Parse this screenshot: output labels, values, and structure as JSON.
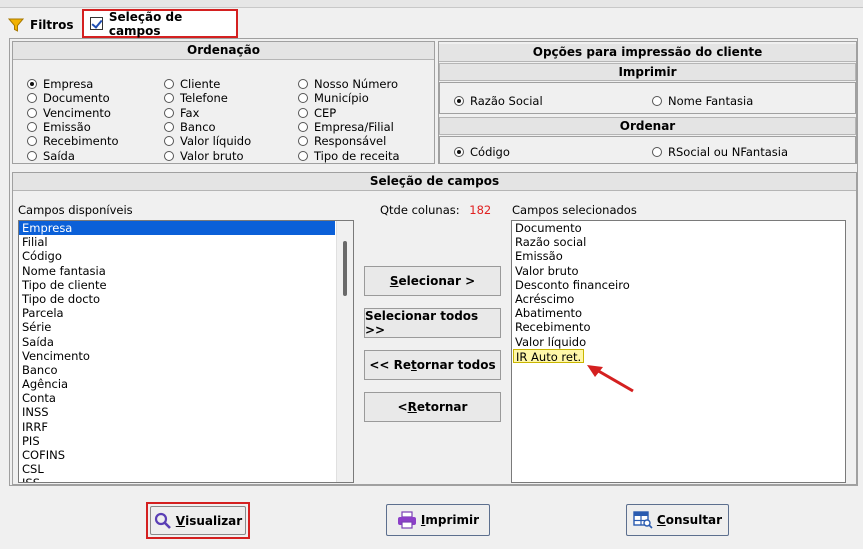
{
  "tabs": {
    "filtros": "Filtros",
    "selecao": "Seleção de campos"
  },
  "ordenacao": {
    "title": "Ordenação",
    "col1": [
      "Empresa",
      "Documento",
      "Vencimento",
      "Emissão",
      "Recebimento",
      "Saída"
    ],
    "col2": [
      "Cliente",
      "Telefone",
      "Fax",
      "Banco",
      "Valor líquido",
      "Valor bruto"
    ],
    "col3": [
      "Nosso Número",
      "Município",
      "CEP",
      "Empresa/Filial",
      "Responsável",
      "Tipo de receita"
    ],
    "selected": "Empresa"
  },
  "opcoes": {
    "title": "Opções para impressão do cliente",
    "imprimir_title": "Imprimir",
    "imprimir_opts": [
      "Razão Social",
      "Nome Fantasia"
    ],
    "ordenar_title": "Ordenar",
    "ordenar_opts": [
      "Código",
      "RSocial ou NFantasia"
    ]
  },
  "selecao": {
    "title": "Seleção de campos",
    "disponiveis_label": "Campos disponíveis",
    "disponiveis": [
      "Empresa",
      "Filial",
      "Código",
      "Nome fantasia",
      "Tipo de cliente",
      "Tipo de docto",
      "Parcela",
      "Série",
      "Saída",
      "Vencimento",
      "Banco",
      "Agência",
      "Conta",
      "INSS",
      "IRRF",
      "PIS",
      "COFINS",
      "CSL",
      "ISS"
    ],
    "qtde_label": "Qtde colunas:",
    "qtde_value": "182",
    "selecionados_label": "Campos selecionados",
    "selecionados": [
      "Documento",
      "Razão social",
      "Emissão",
      "Valor bruto",
      "Desconto financeiro",
      "Acréscimo",
      "Abatimento",
      "Recebimento",
      "Valor líquido",
      "IR Auto ret."
    ],
    "buttons": {
      "selecionar_pre": "",
      "selecionar_u": "S",
      "selecionar_post": "elecionar >",
      "todos_pre": "Selecionar todos >>",
      "retornar_todos_pre": "<< Re",
      "retornar_todos_u": "t",
      "retornar_todos_post": "ornar todos",
      "retornar_pre": "< ",
      "retornar_u": "R",
      "retornar_post": "etornar"
    }
  },
  "bottom": {
    "visualizar_u": "V",
    "visualizar_post": "isualizar",
    "imprimir_u": "I",
    "imprimir_post": "mprimir",
    "consultar_u": "C",
    "consultar_post": "onsultar"
  },
  "colors": {
    "accent_red": "#d42020",
    "selection_blue": "#0b60d8",
    "highlight_yellow": "#fff7a8"
  }
}
